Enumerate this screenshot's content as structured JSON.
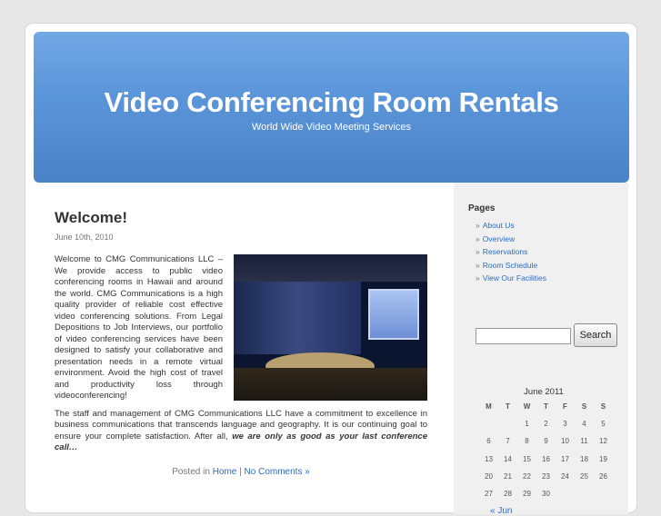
{
  "header": {
    "title": "Video Conferencing Room Rentals",
    "description": "World Wide Video Meeting Services"
  },
  "post": {
    "title": "Welcome!",
    "date": "June 10th, 2010",
    "para1": "Welcome to CMG Communications LLC – We provide access to public video conferencing rooms in Hawaii and around the world. CMG Communications is a high quality provider of reliable cost effective video conferencing solutions. From Legal Depositions to Job Interviews, our portfolio of video conferencing services have been designed to satisfy your collaborative and presentation needs in a remote virtual environment. Avoid the high cost of travel and productivity loss through videoconferencing!",
    "para2_text": "The staff and management of CMG Communications LLC have a commitment to excellence in business communications that transcends language and geography. It is our continuing goal to ensure your complete satisfaction. After all, ",
    "para2_emphasis": "we are only as good as your last conference call…",
    "meta_prefix": "Posted in ",
    "meta_category": "Home",
    "meta_separator": " | ",
    "meta_comments": "No Comments »"
  },
  "sidebar": {
    "pages_heading": "Pages",
    "bullet": "»",
    "pages": [
      "About Us",
      "Overview",
      "Reservations",
      "Room Schedule",
      "View Our Facilities"
    ],
    "search_value": "",
    "search_button": "Search"
  },
  "calendar": {
    "caption": "June 2011",
    "weekdays": [
      "M",
      "T",
      "W",
      "T",
      "F",
      "S",
      "S"
    ],
    "weeks": [
      [
        "",
        "",
        "1",
        "2",
        "3",
        "4",
        "5"
      ],
      [
        "6",
        "7",
        "8",
        "9",
        "10",
        "11",
        "12"
      ],
      [
        "13",
        "14",
        "15",
        "16",
        "17",
        "18",
        "19"
      ],
      [
        "20",
        "21",
        "22",
        "23",
        "24",
        "25",
        "26"
      ],
      [
        "27",
        "28",
        "29",
        "30",
        "",
        "",
        ""
      ]
    ],
    "prev_link": "« Jun"
  }
}
